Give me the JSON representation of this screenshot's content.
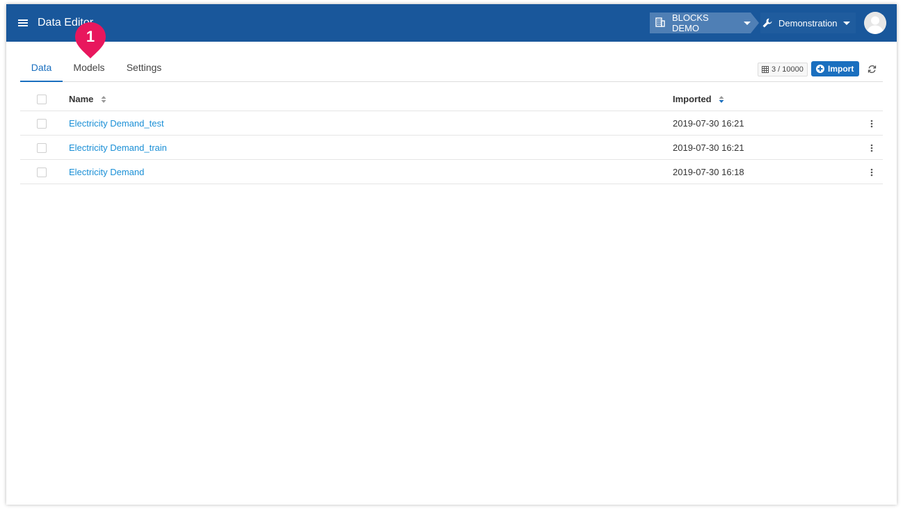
{
  "header": {
    "app_title": "Data Editor",
    "org_label": "BLOCKS DEMO",
    "project_label": "Demonstration"
  },
  "tabs": [
    {
      "label": "Data",
      "active": true
    },
    {
      "label": "Models",
      "active": false
    },
    {
      "label": "Settings",
      "active": false
    }
  ],
  "toolbar": {
    "count_label": "3 / 10000",
    "import_label": "Import"
  },
  "table": {
    "columns": [
      "Name",
      "Imported"
    ],
    "rows": [
      {
        "name": "Electricity Demand_test",
        "imported": "2019-07-30 16:21"
      },
      {
        "name": "Electricity Demand_train",
        "imported": "2019-07-30 16:21"
      },
      {
        "name": "Electricity Demand",
        "imported": "2019-07-30 16:18"
      }
    ]
  },
  "annotation": {
    "number": "1",
    "color": "#e8175d"
  },
  "colors": {
    "header_bg": "#19579b",
    "accent": "#1a6fbf",
    "link": "#1a8fd6"
  },
  "icons": {
    "menu": "menu-icon",
    "org": "building-icon",
    "project": "wrench-icon",
    "avatar": "user-avatar-icon",
    "count": "table-icon",
    "import": "plus-circle-icon",
    "refresh": "refresh-icon",
    "row_menu": "more-vertical-icon"
  }
}
